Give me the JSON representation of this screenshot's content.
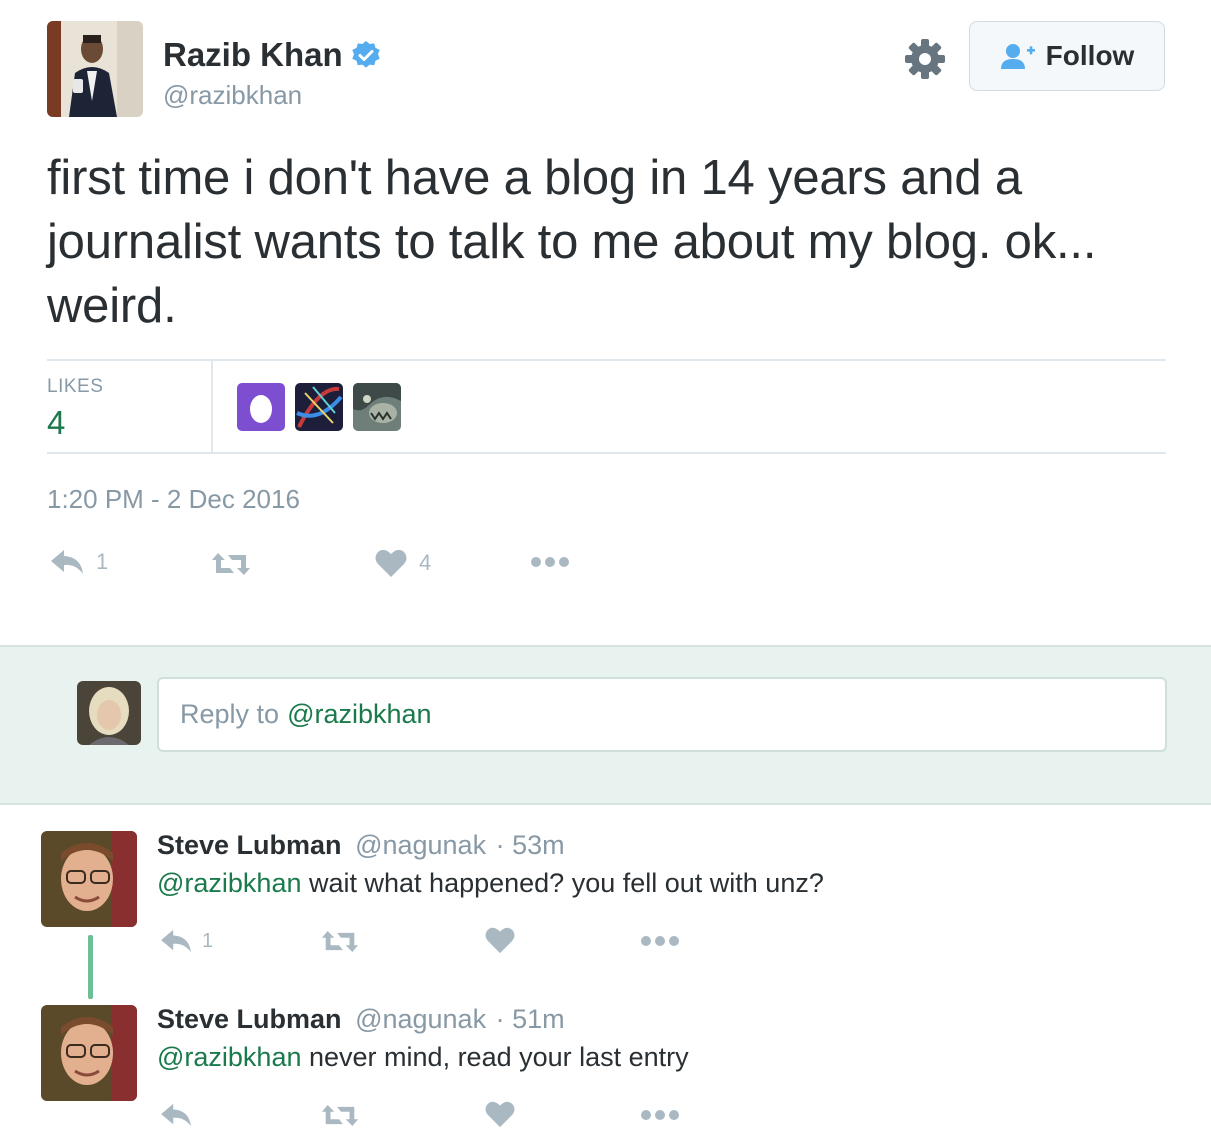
{
  "tweet": {
    "author_name": "Razib Khan",
    "author_handle": "@razibkhan",
    "verified": true,
    "follow_label": "Follow",
    "text": "first time i don't have a blog in 14 years and a journalist wants to talk to me about my blog. ok... weird.",
    "likes_label": "LIKES",
    "likes_count": "4",
    "likers": [
      {
        "icon": "egg-avatar",
        "color": "#7e4ed1"
      },
      {
        "icon": "dna-avatar"
      },
      {
        "icon": "creature-avatar"
      }
    ],
    "timestamp": "1:20 PM - 2 Dec 2016",
    "actions": {
      "reply_count": "1",
      "retweet_count": "",
      "like_count": "4"
    }
  },
  "compose": {
    "placeholder_prefix": "Reply to",
    "mention": "@razibkhan"
  },
  "replies": [
    {
      "name": "Steve Lubman",
      "handle": "@nagunak",
      "time": "· 53m",
      "mention": "@razibkhan",
      "text": "wait what happened? you fell out with unz?",
      "reply_count": "1"
    },
    {
      "name": "Steve Lubman",
      "handle": "@nagunak",
      "time": "· 51m",
      "mention": "@razibkhan",
      "text": "never mind, read your last entry",
      "reply_count": ""
    }
  ],
  "colors": {
    "accent_green": "#1b7a4b",
    "muted": "#8899a6",
    "verified_blue": "#55acee",
    "icon_gray": "#aab8c2"
  }
}
